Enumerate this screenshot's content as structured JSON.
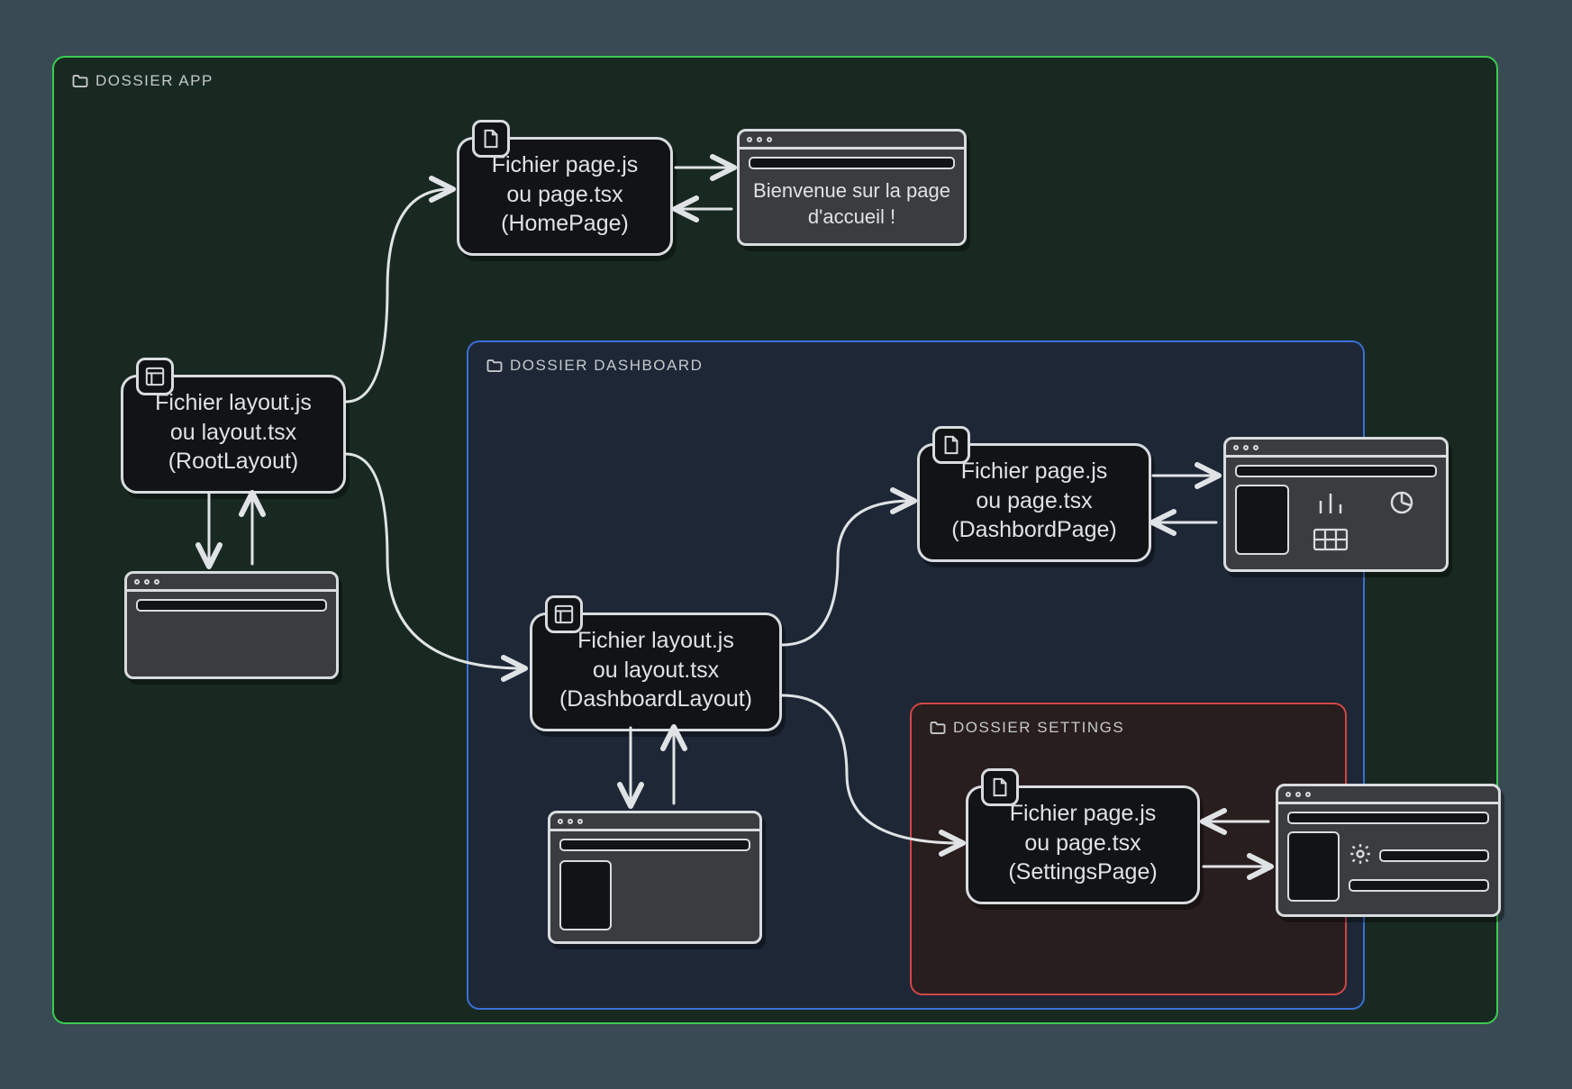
{
  "folders": {
    "app": "DOSSIER APP",
    "dashboard": "DOSSIER DASHBOARD",
    "settings": "DOSSIER SETTINGS"
  },
  "cards": {
    "root_layout": {
      "line1": "Fichier layout.js",
      "line2": "ou layout.tsx",
      "line3": "(RootLayout)"
    },
    "home_page": {
      "line1": "Fichier page.js",
      "line2": "ou page.tsx",
      "line3": "(HomePage)"
    },
    "dashboard_layout": {
      "line1": "Fichier layout.js",
      "line2": "ou layout.tsx",
      "line3": "(DashboardLayout)"
    },
    "dashboard_page": {
      "line1": "Fichier page.js",
      "line2": "ou page.tsx",
      "line3": "(DashbordPage)"
    },
    "settings_page": {
      "line1": "Fichier page.js",
      "line2": "ou page.tsx",
      "line3": "(SettingsPage)"
    }
  },
  "preview": {
    "home": "Bienvenue sur la page d'accueil !"
  },
  "colors": {
    "app_border": "#3acb51",
    "dashboard_border": "#3a6fd6",
    "settings_border": "#d24646"
  }
}
